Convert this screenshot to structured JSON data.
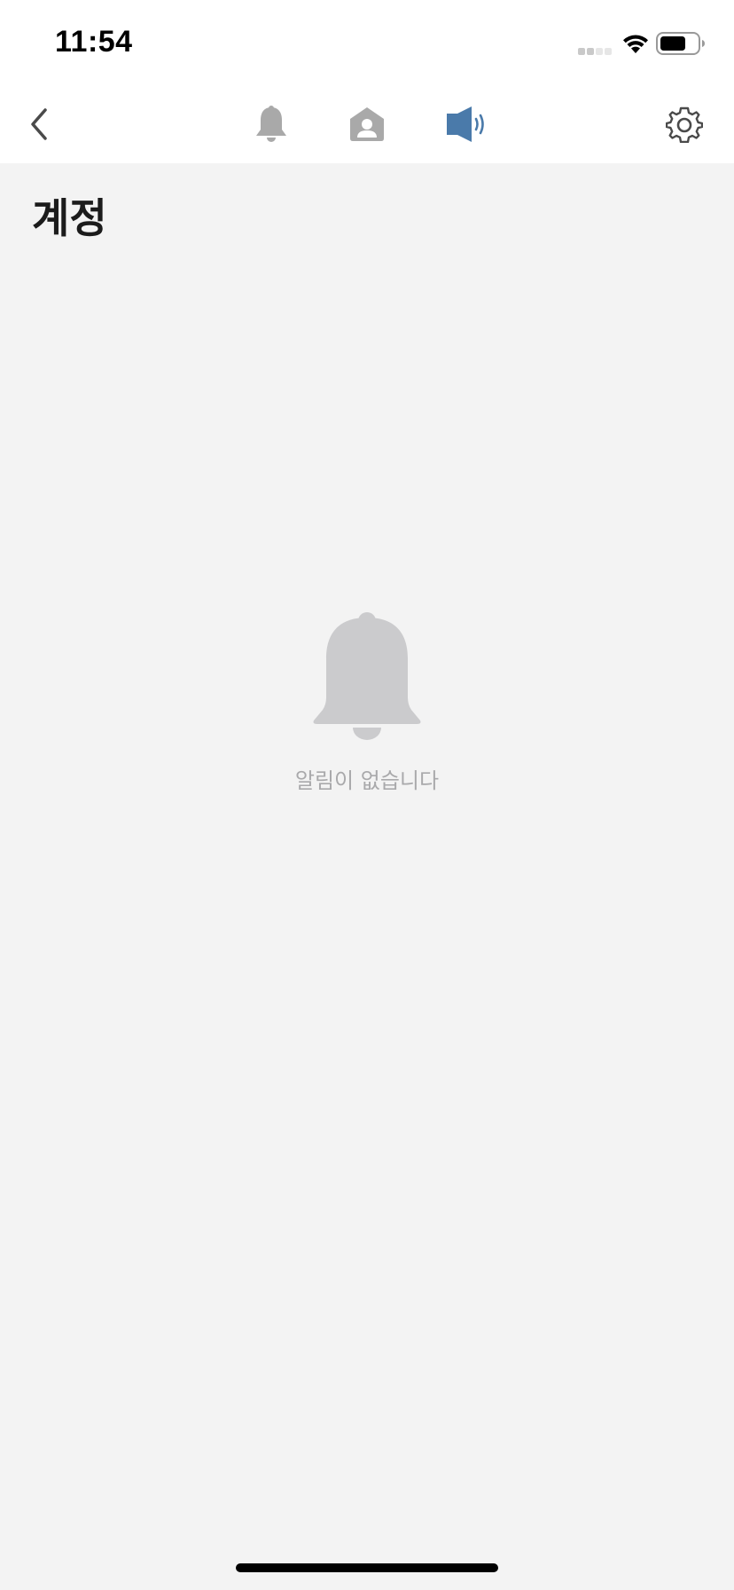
{
  "status_bar": {
    "time": "11:54"
  },
  "nav": {
    "back_icon": "chevron-left-icon",
    "tabs": [
      {
        "icon": "bell-icon",
        "active": false
      },
      {
        "icon": "contact-card-icon",
        "active": false
      },
      {
        "icon": "speaker-icon",
        "active": true
      }
    ],
    "settings_icon": "gear-icon"
  },
  "page": {
    "title": "계정"
  },
  "empty_state": {
    "icon": "bell-icon",
    "message": "알림이 없습니다"
  },
  "colors": {
    "background": "#f3f3f3",
    "bar_background": "#ffffff",
    "inactive_icon": "#a9a9a9",
    "active_icon": "#4a7aaa",
    "empty_icon": "#cbcbcd",
    "empty_text": "#a9a9ab",
    "title_text": "#1b1b1b"
  }
}
